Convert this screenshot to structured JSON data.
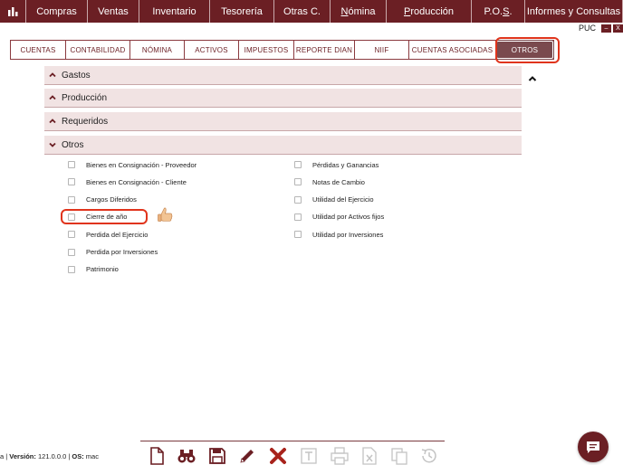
{
  "menu": {
    "items": [
      {
        "label": "Compras",
        "width": 68
      },
      {
        "label": "Ventas",
        "width": 57
      },
      {
        "label": "Inventario",
        "width": 78
      },
      {
        "label": "Tesorería",
        "width": 71
      },
      {
        "label": "Otras C.",
        "width": 62
      },
      {
        "label_pre": "",
        "label_u": "N",
        "label_post": "ómina",
        "width": 62
      },
      {
        "label_pre": "",
        "label_u": "P",
        "label_post": "roducción",
        "width": 94
      },
      {
        "label_pre": "P.O.",
        "label_u": "S",
        "label_post": ".",
        "width": 59
      },
      {
        "label": "Informes y Consultas",
        "width": 108
      }
    ]
  },
  "window": {
    "title": "PUC",
    "minimize_label": "–",
    "close_label": "X"
  },
  "tabs": [
    {
      "label": "CUENTAS",
      "width": 61
    },
    {
      "label": "CONTABILIDAD",
      "width": 71
    },
    {
      "label": "NÓMINA",
      "width": 60
    },
    {
      "label": "ACTIVOS",
      "width": 60
    },
    {
      "label": "IMPUESTOS",
      "width": 61
    },
    {
      "label": "REPORTE DIAN",
      "width": 67
    },
    {
      "label": "NIIF",
      "width": 60
    },
    {
      "label": "CUENTAS ASOCIADAS",
      "width": 96
    },
    {
      "label": "OTROS",
      "width": 63,
      "active": true
    }
  ],
  "sections": [
    {
      "label": "Gastos",
      "expanded": false
    },
    {
      "label": "Producción",
      "expanded": false
    },
    {
      "label": "Requeridos",
      "expanded": false
    },
    {
      "label": "Otros",
      "expanded": true
    }
  ],
  "otros_items_left": [
    "Bienes en Consignación - Proveedor",
    "Bienes en Consignación - Cliente",
    "Cargos Diferidos",
    "Cierre de año",
    "Perdida del Ejercicio",
    "Perdida por Inversiones",
    "Patrimonio"
  ],
  "otros_items_right": [
    "Pérdidas y Ganancias",
    "Notas de Cambio",
    "Utilidad del Ejercicio",
    "Utilidad por Activos fijos",
    "Utilidad por Inversiones"
  ],
  "footer": {
    "prefix": "a | ",
    "version_label": "Versión:",
    "version_value": " 121.0.0.0 | ",
    "os_label": "OS:",
    "os_value": " mac"
  },
  "toolbar": [
    "new-document-icon",
    "binoculars-icon",
    "save-icon",
    "pencil-icon",
    "delete-icon",
    "text-icon",
    "print-icon",
    "excel-icon",
    "copy-icon",
    "history-icon"
  ],
  "colors": {
    "brand": "#6b1f24",
    "highlight": "#e0341c",
    "section_bg": "#f1e3e3"
  }
}
